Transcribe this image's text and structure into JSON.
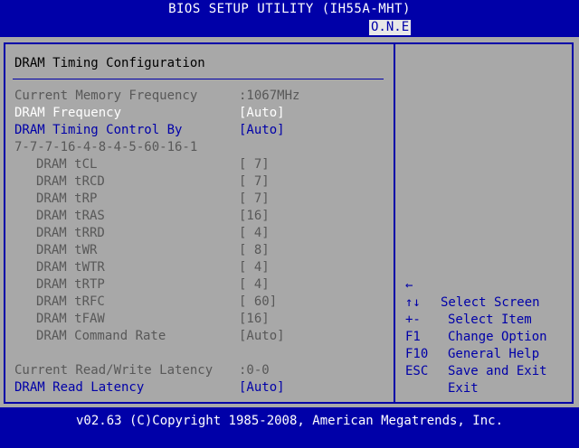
{
  "title": "BIOS SETUP UTILITY (IH55A-MHT)",
  "tab": "O.N.E",
  "section_title": "DRAM Timing Configuration",
  "settings": [
    {
      "label": "Current Memory Frequency",
      "value": ":1067MHz",
      "state": "info"
    },
    {
      "label": "DRAM Frequency",
      "value": "[Auto]",
      "state": "selected"
    },
    {
      "label": "DRAM Timing Control By",
      "value": "[Auto]",
      "state": "editable"
    },
    {
      "label": "7-7-7-16-4-8-4-5-60-16-1",
      "value": "",
      "state": "info"
    },
    {
      "label": "DRAM tCL",
      "value": "[ 7]",
      "state": "disabled"
    },
    {
      "label": "DRAM tRCD",
      "value": "[ 7]",
      "state": "disabled"
    },
    {
      "label": "DRAM tRP",
      "value": "[ 7]",
      "state": "disabled"
    },
    {
      "label": "DRAM tRAS",
      "value": "[16]",
      "state": "disabled"
    },
    {
      "label": "DRAM tRRD",
      "value": "[ 4]",
      "state": "disabled"
    },
    {
      "label": "DRAM tWR",
      "value": "[ 8]",
      "state": "disabled"
    },
    {
      "label": "DRAM tWTR",
      "value": "[ 4]",
      "state": "disabled"
    },
    {
      "label": "DRAM tRTP",
      "value": "[ 4]",
      "state": "disabled"
    },
    {
      "label": "DRAM tRFC",
      "value": "[ 60]",
      "state": "disabled"
    },
    {
      "label": "DRAM tFAW",
      "value": "[16]",
      "state": "disabled"
    },
    {
      "label": "DRAM Command Rate",
      "value": "[Auto]",
      "state": "disabled"
    },
    {
      "label": "Current Read/Write Latency",
      "value": ":0-0",
      "state": "info"
    },
    {
      "label": "DRAM Read Latency",
      "value": "[Auto]",
      "state": "editable"
    }
  ],
  "help": [
    {
      "key": "←",
      "desc": "Select Screen"
    },
    {
      "key": "↑↓",
      "desc": "Select Item"
    },
    {
      "key": "+-",
      "desc": "Change Option"
    },
    {
      "key": "F1",
      "desc": "General Help"
    },
    {
      "key": "F10",
      "desc": "Save and Exit"
    },
    {
      "key": "ESC",
      "desc": "Exit"
    }
  ],
  "footer": "v02.63 (C)Copyright 1985-2008, American Megatrends, Inc.",
  "colors": {
    "background": "#0000a8",
    "panel": "#a8a8a8",
    "selected_text": "#ffffff",
    "editable_text": "#0000a8",
    "disabled_text": "#585858"
  }
}
